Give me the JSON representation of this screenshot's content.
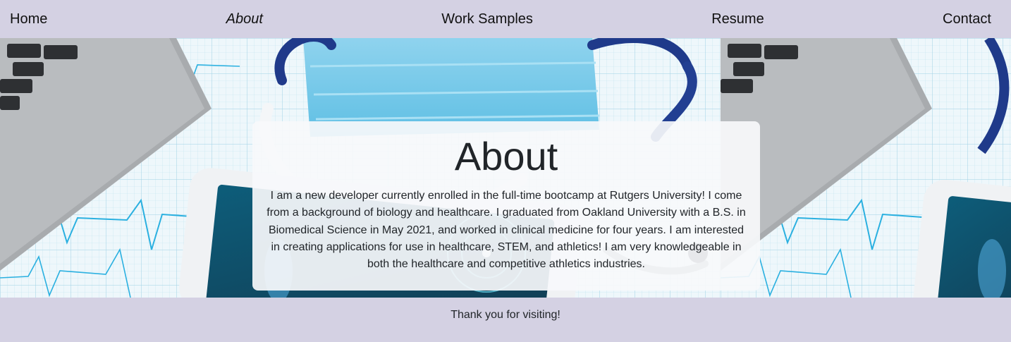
{
  "nav": {
    "items": [
      {
        "label": "Home"
      },
      {
        "label": "About",
        "active": true
      },
      {
        "label": "Work Samples"
      },
      {
        "label": "Resume"
      },
      {
        "label": "Contact"
      }
    ]
  },
  "about": {
    "title": "About",
    "body": "I am a new developer currently enrolled in the full-time bootcamp at Rutgers University! I come from a background of biology and healthcare. I graduated from Oakland University with a B.S. in Biomedical Science in May 2021, and worked in clinical medicine for four years. I am interested in creating applications for use in healthcare, STEM, and athletics! I am very knowledgeable in both the healthcare and competitive athletics industries."
  },
  "footer": {
    "text": "Thank you for visiting!"
  },
  "colors": {
    "page_background": "#d4d1e3",
    "card_background": "#f7f8fb",
    "text": "#212529"
  },
  "hero_image": {
    "icons": [
      "laptop-icon",
      "stethoscope-icon",
      "medical-mask-icon",
      "tablet-icon",
      "ecg-grid-icon"
    ]
  }
}
